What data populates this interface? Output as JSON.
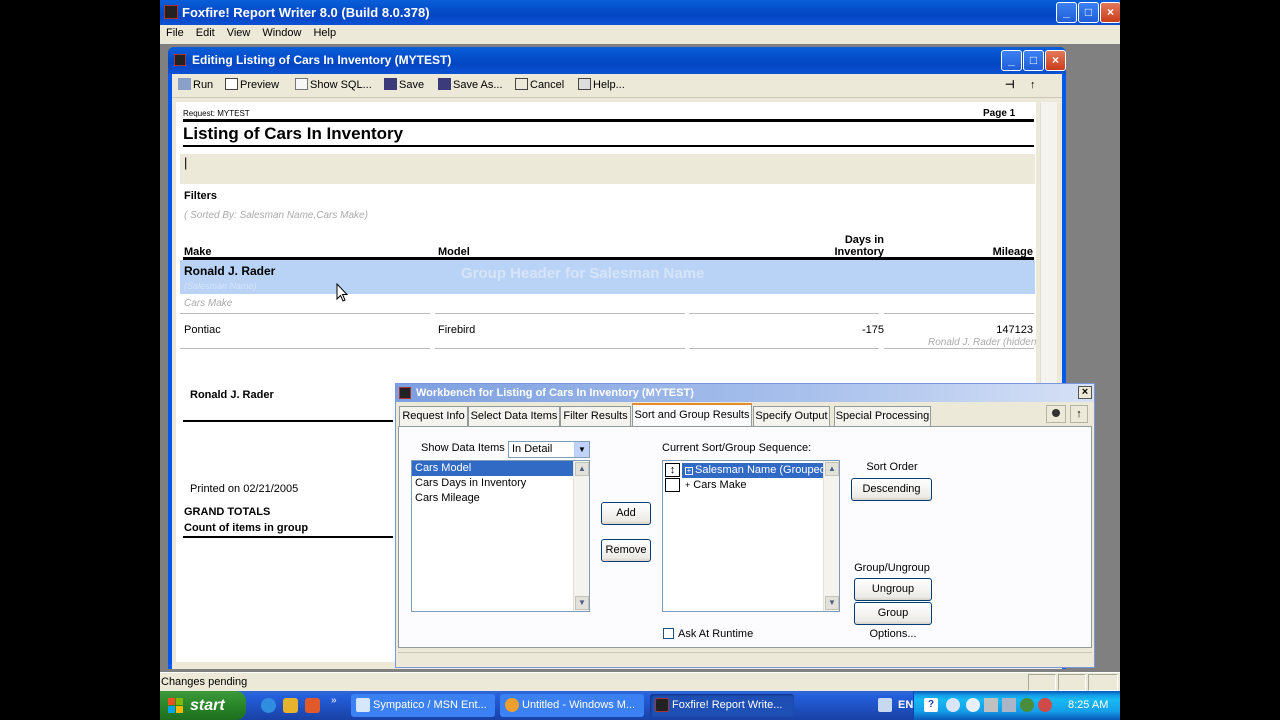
{
  "app": {
    "title": "Foxfire! Report Writer 8.0 (Build 8.0.378)",
    "menu": [
      "File",
      "Edit",
      "View",
      "Window",
      "Help"
    ],
    "status": "Changes pending",
    "window_buttons": [
      "_",
      "□",
      "×"
    ]
  },
  "editor": {
    "title": "Editing Listing of Cars In Inventory (MYTEST)",
    "toolbar": {
      "run": "Run",
      "preview": "Preview",
      "show_sql": "Show SQL...",
      "save": "Save",
      "save_as": "Save As...",
      "cancel": "Cancel",
      "help": "Help...",
      "pin": "⊣",
      "up": "↑"
    }
  },
  "report": {
    "request_label": "Request: MYTEST",
    "page_label": "Page 1",
    "title": "Listing of Cars In Inventory",
    "cursor_mark": "|",
    "filters_label": "Filters",
    "sorted_by": "( Sorted By:    Salesman Name,Cars Make)",
    "columns": {
      "make": "Make",
      "model": "Model",
      "days_line1": "Days in",
      "days_line2": "Inventory",
      "mileage": "Mileage"
    },
    "group_header": {
      "name": "Ronald J. Rader",
      "caption": "Group Header for Salesman Name",
      "field1": "(Salesman Name)",
      "field2": "Cars Make"
    },
    "detail": {
      "make": "Pontiac",
      "model": "Firebird",
      "days": "-175",
      "mileage": "147123",
      "hidden": "Ronald J. Rader (hidden)"
    },
    "group_footer_name": "Ronald J. Rader",
    "printed_on": "Printed on 02/21/2005",
    "grand_totals": "GRAND TOTALS",
    "count_label": "Count of items in group"
  },
  "workbench": {
    "title": "Workbench for Listing of Cars In Inventory (MYTEST)",
    "close": "×",
    "tabs": [
      {
        "label": "Request Info"
      },
      {
        "label": "Select Data Items"
      },
      {
        "label": "Filter Results"
      },
      {
        "label": "Sort and Group Results"
      },
      {
        "label": "Specify Output"
      },
      {
        "label": "Special Processing"
      }
    ],
    "active_tab": "Sort and Group Results",
    "show_data_items_label": "Show Data Items :",
    "show_data_items_value": "In Detail",
    "available_items": [
      "Cars Model",
      "Cars Days in Inventory",
      "Cars Mileage"
    ],
    "add_label": "Add",
    "remove_label": "Remove",
    "sequence_label": "Current Sort/Group Sequence:",
    "sequence": [
      {
        "label": "Salesman Name (Grouped)"
      },
      {
        "label": "Cars Make"
      }
    ],
    "sort_order_label": "Sort Order",
    "descending_label": "Descending",
    "group_ungroup_label": "Group/Ungroup",
    "ungroup_label": "Ungroup",
    "group_options_label": "Group Options...",
    "ask_runtime_label": "Ask At Runtime"
  },
  "taskbar": {
    "start": "start",
    "tasks": [
      {
        "label": "Sympatico / MSN Ent..."
      },
      {
        "label": "Untitled - Windows M..."
      },
      {
        "label": "Foxfire! Report Write..."
      }
    ],
    "tray_en": "EN",
    "clock": "8:25 AM"
  },
  "colors": {
    "xp_blue": "#0a5fd9",
    "group_band": "#b8d3f5",
    "selection": "#316ac5",
    "start_green": "#2c8a2c"
  }
}
